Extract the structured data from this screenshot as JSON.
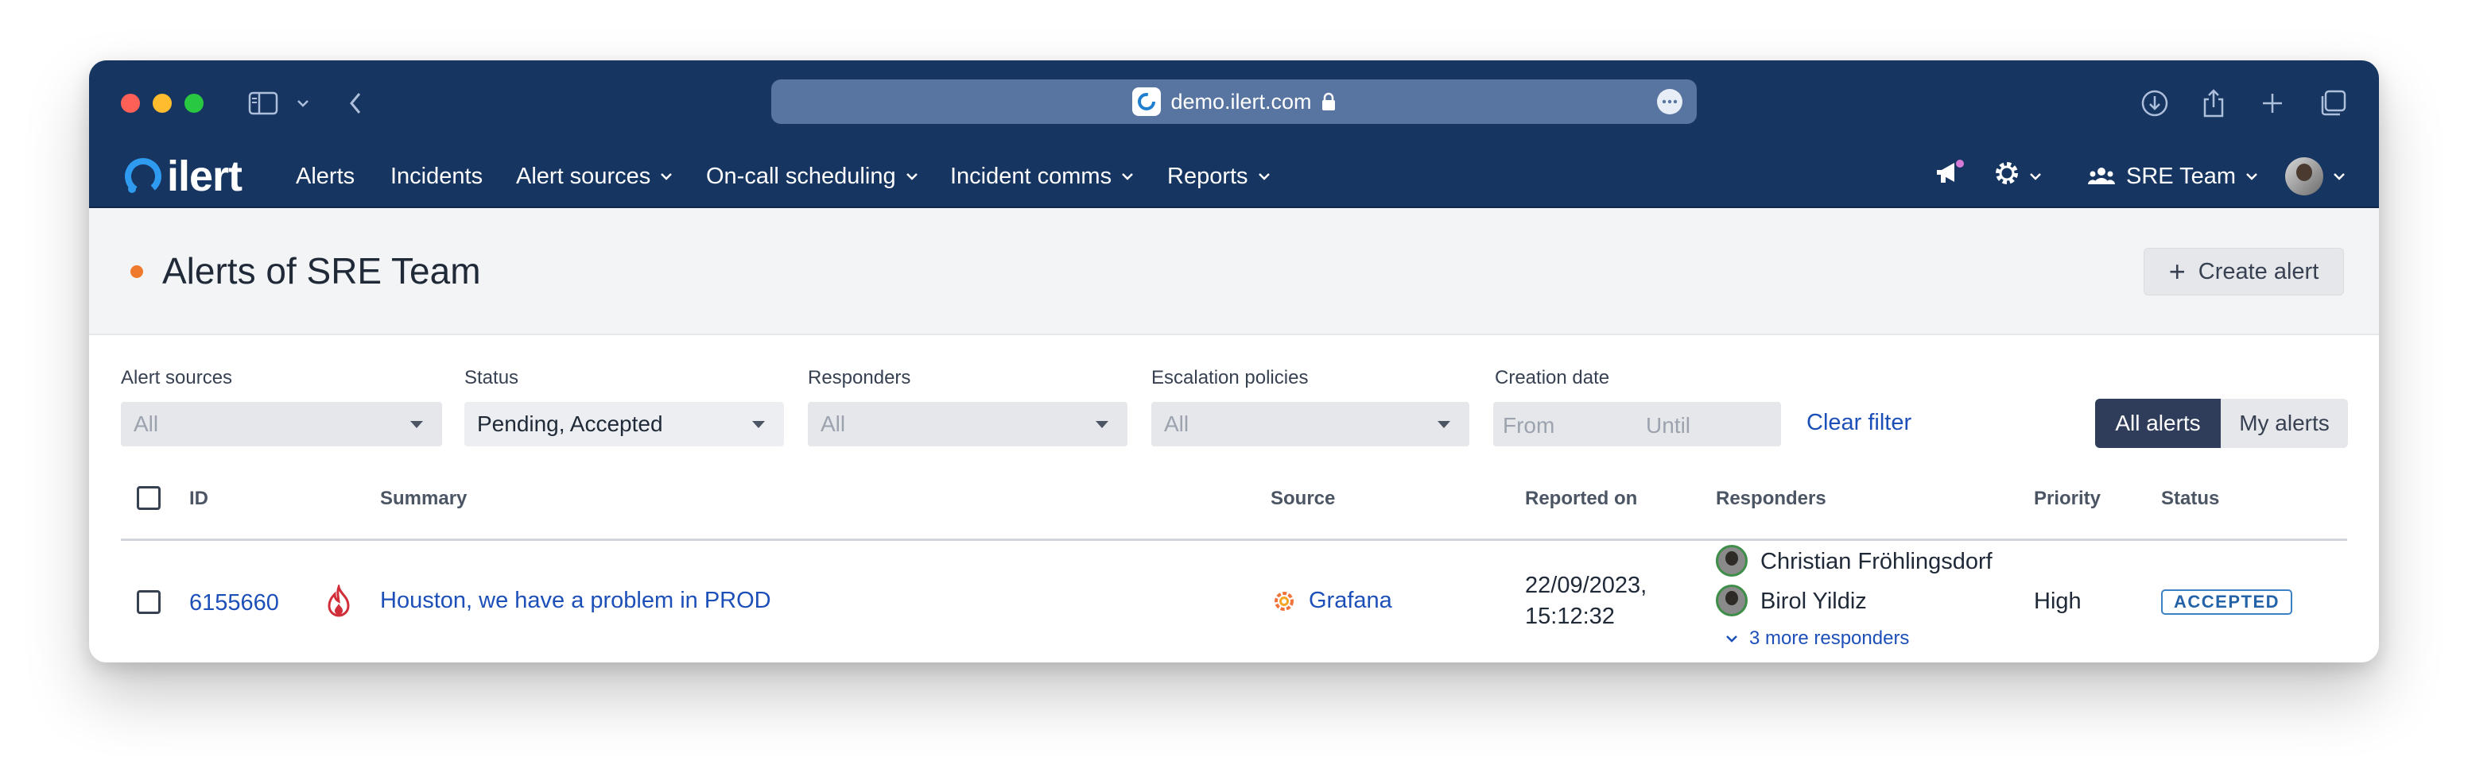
{
  "browser": {
    "url": "demo.ilert.com"
  },
  "nav": {
    "logo_text": "ilert",
    "items": [
      {
        "label": "Alerts"
      },
      {
        "label": "Incidents"
      },
      {
        "label": "Alert sources"
      },
      {
        "label": "On-call scheduling"
      },
      {
        "label": "Incident comms"
      },
      {
        "label": "Reports"
      }
    ],
    "team_label": "SRE Team"
  },
  "page": {
    "title": "Alerts of SRE Team",
    "create_button": "Create alert"
  },
  "filters": {
    "alert_sources": {
      "label": "Alert sources",
      "value": "All"
    },
    "status": {
      "label": "Status",
      "value": "Pending, Accepted"
    },
    "responders": {
      "label": "Responders",
      "value": "All"
    },
    "escalation_policies": {
      "label": "Escalation policies",
      "value": "All"
    },
    "creation_date": {
      "label": "Creation date",
      "from_placeholder": "From",
      "until_placeholder": "Until"
    },
    "clear_filter": "Clear filter",
    "all_alerts": "All alerts",
    "my_alerts": "My alerts"
  },
  "table": {
    "columns": {
      "id": "ID",
      "summary": "Summary",
      "source": "Source",
      "reported_on": "Reported on",
      "responders": "Responders",
      "priority": "Priority",
      "status": "Status"
    },
    "rows": [
      {
        "id": "6155660",
        "summary": "Houston, we have a problem in PROD",
        "source": "Grafana",
        "reported_date": "22/09/2023,",
        "reported_time": "15:12:32",
        "responders": [
          "Christian Fröhlingsdorf",
          "Birol Yildiz"
        ],
        "more_responders": "3 more responders",
        "priority": "High",
        "status": "ACCEPTED"
      }
    ]
  },
  "colors": {
    "nav_bg": "#163560",
    "accent_link": "#1d4fb8",
    "status_dot": "#f07a2b",
    "segment_active": "#2f3d5a"
  }
}
